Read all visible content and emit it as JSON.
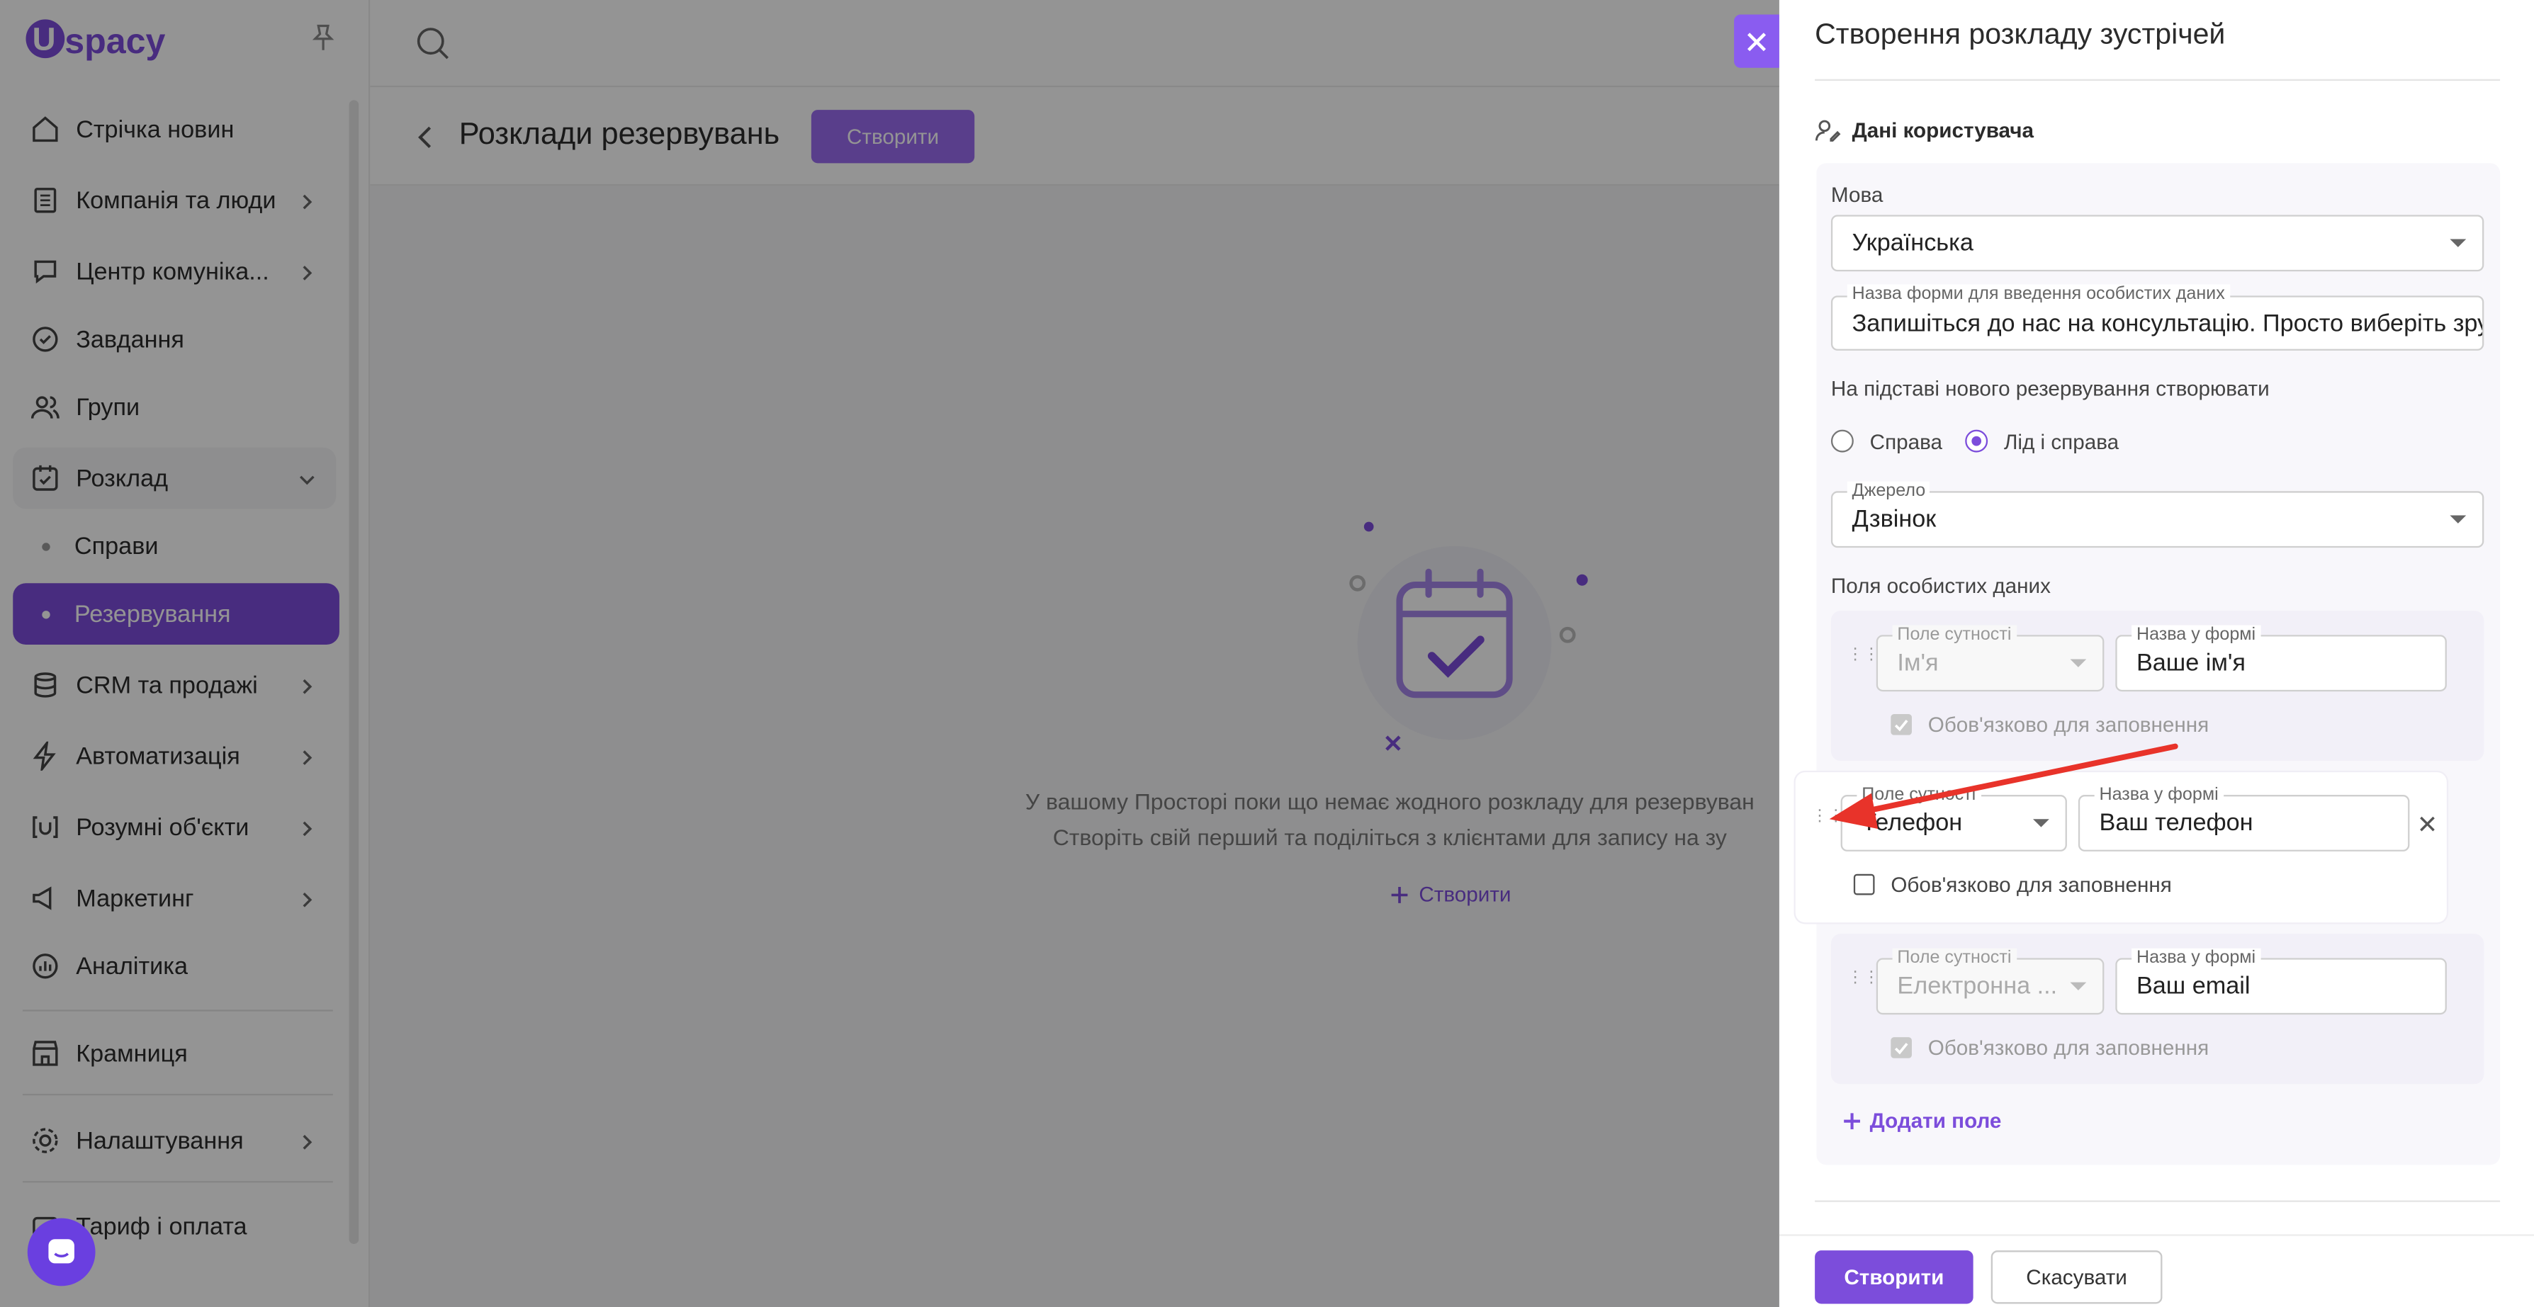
{
  "sidebar": {
    "logo_text": "spacy",
    "items": [
      {
        "label": "Стрічка новин",
        "icon": "home-icon"
      },
      {
        "label": "Компанія та люди",
        "icon": "building-icon"
      },
      {
        "label": "Центр комуніка...",
        "icon": "chat-edit-icon"
      },
      {
        "label": "Завдання",
        "icon": "check-circle-icon"
      },
      {
        "label": "Групи",
        "icon": "users-icon"
      },
      {
        "label": "Розклад",
        "icon": "calendar-check-icon"
      },
      {
        "label": "CRM та продажі",
        "icon": "database-icon"
      },
      {
        "label": "Автоматизація",
        "icon": "lightning-icon"
      },
      {
        "label": "Розумні об'єкти",
        "icon": "smart-object-icon"
      },
      {
        "label": "Маркетинг",
        "icon": "megaphone-icon"
      },
      {
        "label": "Аналітика",
        "icon": "chart-icon"
      },
      {
        "label": "Крамниця",
        "icon": "store-icon"
      },
      {
        "label": "Налаштування",
        "icon": "gear-icon"
      },
      {
        "label": "Тариф і оплата",
        "icon": "wallet-icon"
      }
    ],
    "sub_items": [
      {
        "label": "Справи"
      },
      {
        "label": "Резервування"
      }
    ]
  },
  "main": {
    "title": "Розклади резервувань",
    "create_button": "Створити",
    "empty_line1": "У вашому Просторі поки що немає жодного розкладу для резервуван",
    "empty_line2": "Створіть свій перший та поділіться з клієнтами для запису на зу",
    "empty_create_link": "Створити"
  },
  "panel": {
    "title": "Створення розкладу зустрічей",
    "section_title": "Дані користувача",
    "language_label": "Мова",
    "language_value": "Українська",
    "form_name_label": "Назва форми для введення особистих даних",
    "form_name_value": "Запишіться до нас на консультацію. Просто виберіть зручну",
    "create_based_label": "На підставі нового резервування створювати",
    "radio_options": [
      {
        "label": "Справа",
        "selected": false
      },
      {
        "label": "Лід і справа",
        "selected": true
      }
    ],
    "source_label": "Джерело",
    "source_value": "Дзвінок",
    "personal_fields_label": "Поля особистих даних",
    "fields": [
      {
        "entity_label": "Поле сутності",
        "entity_value": "Ім'я",
        "form_label": "Назва у формі",
        "form_value": "Ваше ім'я",
        "required_label": "Обов'язково для заповнення",
        "required": true,
        "locked": true
      },
      {
        "entity_label": "Поле сутності",
        "entity_value": "Телефон",
        "form_label": "Назва у формі",
        "form_value": "Ваш телефон",
        "required_label": "Обов'язково для заповнення",
        "required": false,
        "locked": false
      },
      {
        "entity_label": "Поле сутності",
        "entity_value": "Електронна ...",
        "form_label": "Назва у формі",
        "form_value": "Ваш email",
        "required_label": "Обов'язково для заповнення",
        "required": true,
        "locked": true
      }
    ],
    "add_field": "Додати поле",
    "submit_button": "Створити",
    "cancel_button": "Скасувати"
  },
  "colors": {
    "accent": "#7c4ddb",
    "annotation_arrow": "#e8332a"
  }
}
